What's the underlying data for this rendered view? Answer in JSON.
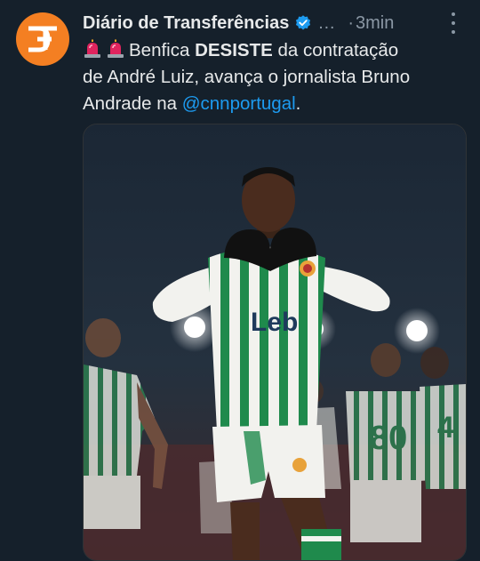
{
  "account": {
    "display_name": "Diário de Transferências",
    "handle": "…",
    "separator": "·",
    "timestamp": "3min",
    "avatar_icon": "dt-logo-icon",
    "verified_icon": "verified-badge-icon"
  },
  "tweet": {
    "line1_text": "Benfica ",
    "line1_bold": "DESISTE",
    "line1_rest": " da contratação",
    "line2": "de André Luiz, avança o jornalista Bruno",
    "line3_text": "Andrade na ",
    "mention": "@cnnportugal",
    "line3_end": ".",
    "emoji_icons": [
      "siren-icon",
      "siren-icon"
    ]
  },
  "media": {
    "shirt_sponsor": "Leb",
    "shirt_number_1": "80",
    "shirt_number_2": "4",
    "colors": {
      "stripe_green": "#1f8a4c",
      "shirt_white": "#f2f2ee",
      "background": "#1c2a38"
    }
  },
  "colors": {
    "background": "#15202b",
    "text": "#e7e9ea",
    "muted": "#8b98a5",
    "link": "#1d9bf0",
    "avatar": "#f47f22"
  }
}
